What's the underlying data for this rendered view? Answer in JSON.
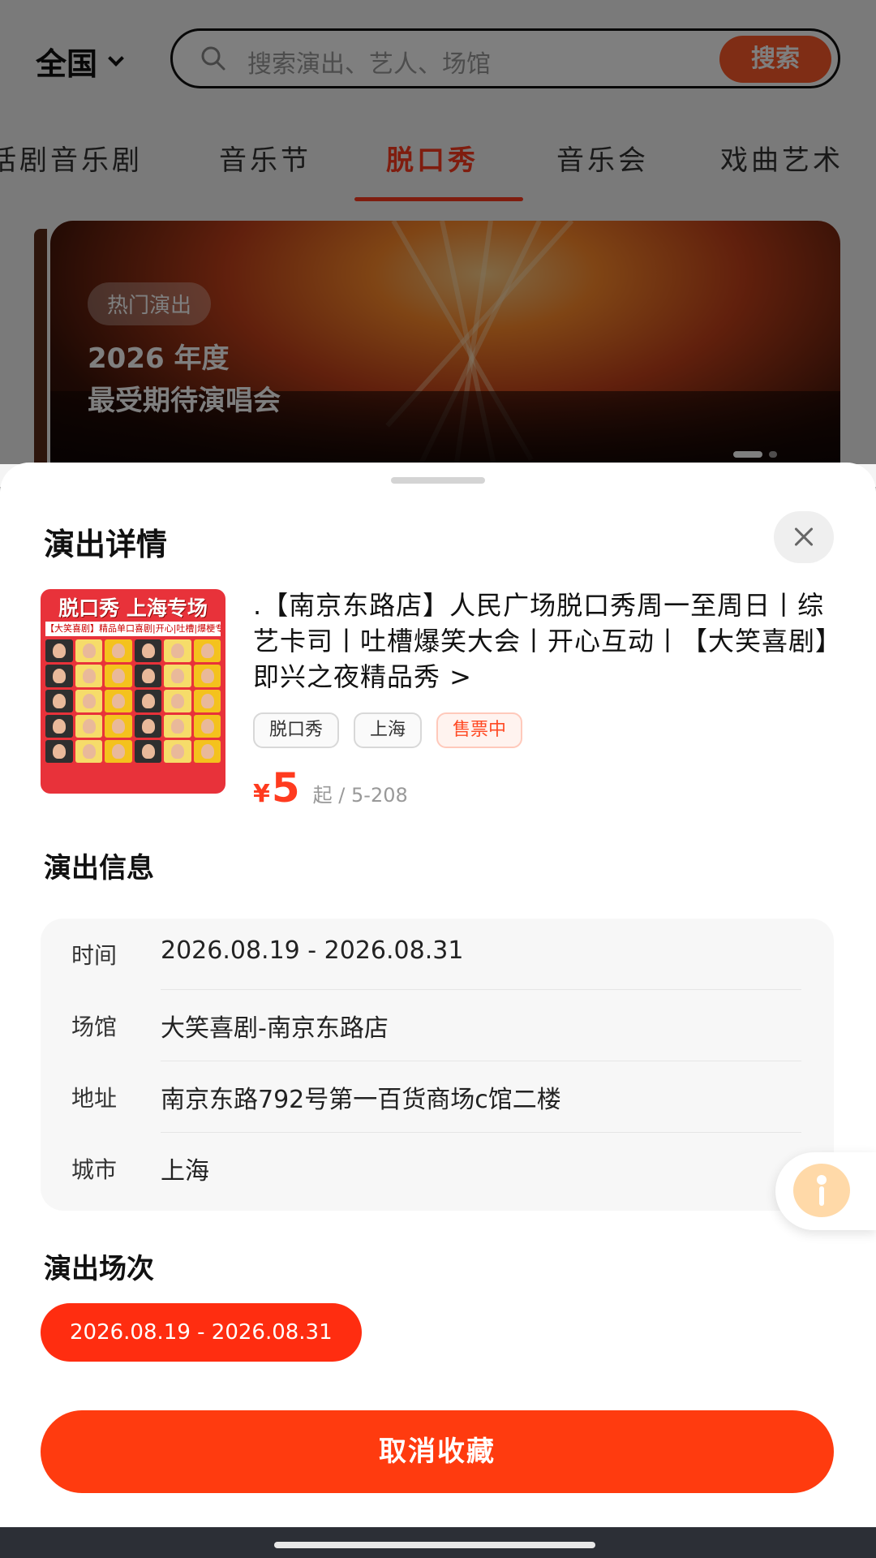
{
  "header": {
    "city": "全国",
    "search_placeholder": "搜索演出、艺人、场馆",
    "search_button": "搜索"
  },
  "tabs": [
    {
      "label": "话剧音乐剧",
      "active": false
    },
    {
      "label": "音乐节",
      "active": false
    },
    {
      "label": "脱口秀",
      "active": true
    },
    {
      "label": "音乐会",
      "active": false
    },
    {
      "label": "戏曲艺术",
      "active": false
    }
  ],
  "banner": {
    "tag": "热门演出",
    "headline_line1": "2026 年度",
    "headline_line2": "最受期待演唱会"
  },
  "sheet": {
    "title": "演出详情",
    "close_icon": "close-icon",
    "poster": {
      "title": "脱口秀 上海专场",
      "subtitle": "【大笑喜剧】精品单口喜剧|开心|吐槽|爆梗专场"
    },
    "show_title": ".【南京东路店】人民广场脱口秀周一至周日丨综艺卡司丨吐槽爆笑大会丨开心互动丨【大笑喜剧】即兴之夜精品秀 >",
    "tags": [
      "脱口秀",
      "上海",
      "售票中"
    ],
    "price": {
      "currency": "¥",
      "amount": "5",
      "suffix": "起 / 5-208"
    },
    "info_section_title": "演出信息",
    "info": [
      {
        "key": "时间",
        "value": "2026.08.19 - 2026.08.31"
      },
      {
        "key": "场馆",
        "value": "大笑喜剧-南京东路店"
      },
      {
        "key": "地址",
        "value": "南京东路792号第一百货商场c馆二楼"
      },
      {
        "key": "城市",
        "value": "上海"
      }
    ],
    "sessions_section_title": "演出场次",
    "session": "2026.08.19 - 2026.08.31",
    "cta": "取消收藏"
  },
  "colors": {
    "accent": "#ff3b0f",
    "accent_text": "#ff3b1f",
    "sale_tag": "#ff4a24"
  }
}
